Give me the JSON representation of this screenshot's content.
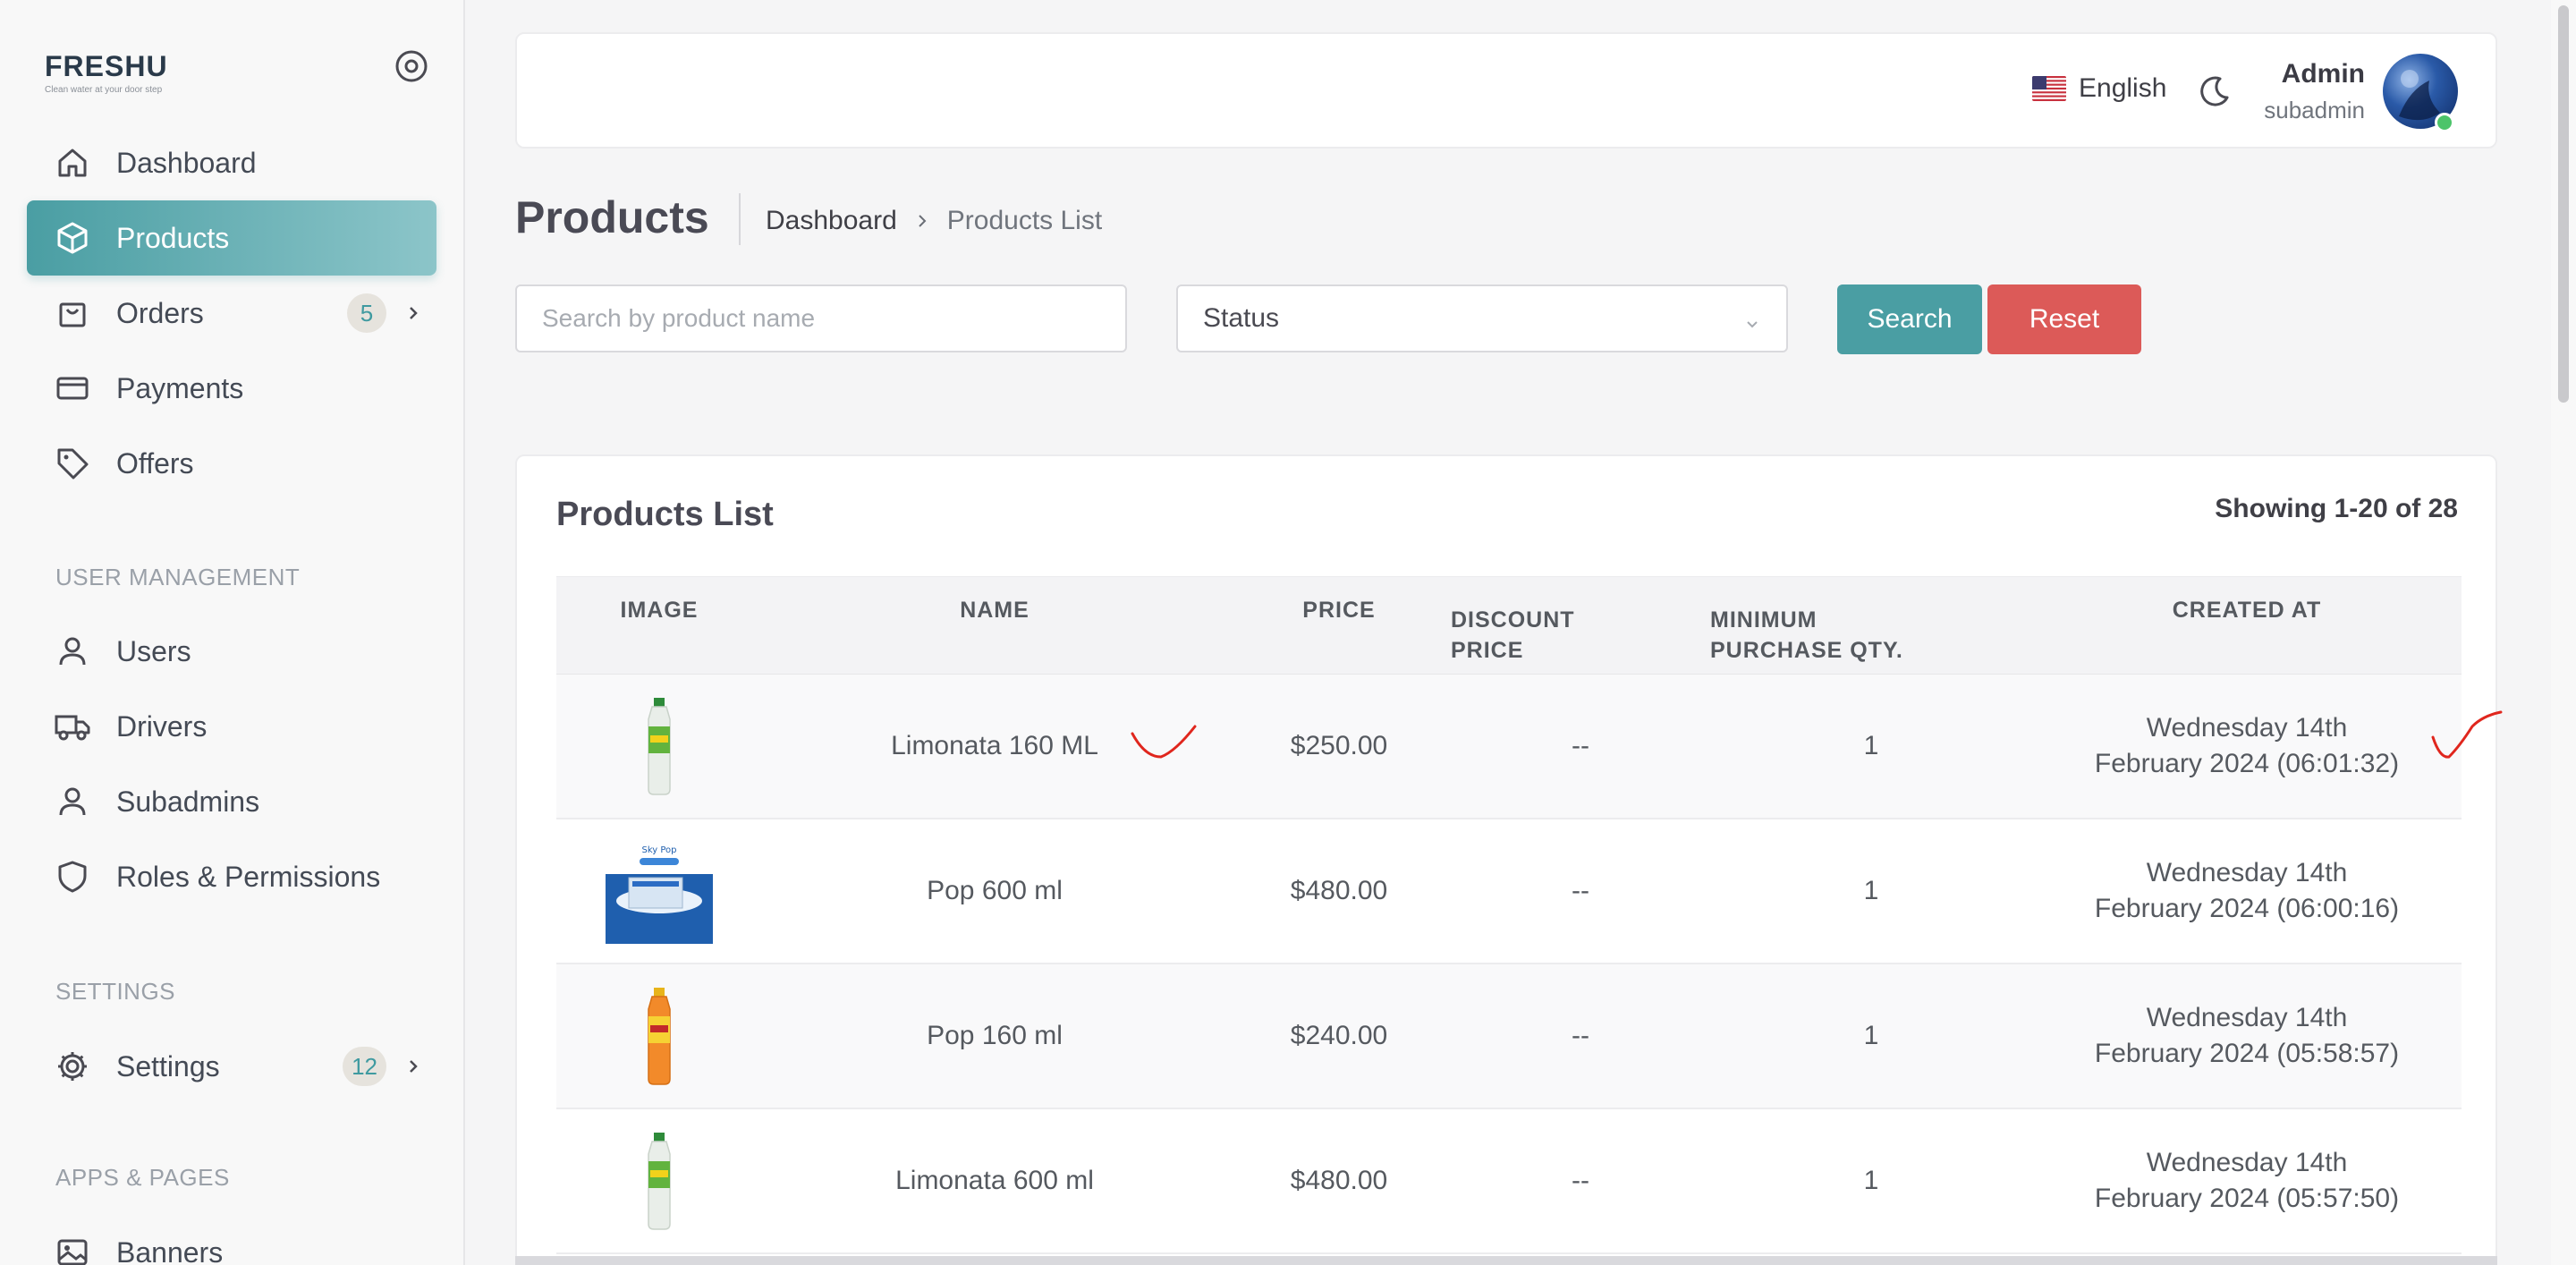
{
  "brand": {
    "name": "FRESHU",
    "tagline": "Clean water at your door step"
  },
  "sidebar": {
    "items": [
      {
        "label": "Dashboard",
        "icon": "home-icon"
      },
      {
        "label": "Products",
        "icon": "box-icon",
        "active": true
      },
      {
        "label": "Orders",
        "icon": "shopping-bag-icon",
        "badge": "5"
      },
      {
        "label": "Payments",
        "icon": "credit-card-icon"
      },
      {
        "label": "Offers",
        "icon": "tag-icon"
      }
    ],
    "sections": {
      "user_management": "USER MANAGEMENT",
      "settings": "SETTINGS",
      "apps_pages": "APPS & PAGES"
    },
    "user_items": [
      {
        "label": "Users",
        "icon": "user-icon"
      },
      {
        "label": "Drivers",
        "icon": "truck-icon"
      },
      {
        "label": "Subadmins",
        "icon": "user-icon"
      },
      {
        "label": "Roles & Permissions",
        "icon": "shield-icon"
      }
    ],
    "settings_item": {
      "label": "Settings",
      "icon": "gear-icon",
      "badge": "12"
    },
    "apps_item": {
      "label": "Banners",
      "icon": "image-icon"
    }
  },
  "topbar": {
    "language": "English",
    "user": {
      "name": "Admin",
      "role": "subadmin"
    }
  },
  "page": {
    "title": "Products",
    "breadcrumb": {
      "root": "Dashboard",
      "current": "Products List"
    }
  },
  "filters": {
    "search_placeholder": "Search by product name",
    "search_value": "",
    "status_label": "Status",
    "search_button": "Search",
    "reset_button": "Reset"
  },
  "table": {
    "title": "Products List",
    "showing": "Showing 1-20 of 28",
    "columns": {
      "image": "IMAGE",
      "name": "NAME",
      "price": "PRICE",
      "discount_1": "DISCOUNT",
      "discount_2": "PRICE",
      "min_1": "MINIMUM",
      "min_2": "PURCHASE QTY.",
      "created": "CREATED AT"
    },
    "rows": [
      {
        "name": "Limonata 160 ML",
        "price": "$250.00",
        "discount": "--",
        "min_qty": "1",
        "created_1": "Wednesday 14th",
        "created_2": "February 2024 (06:01:32)"
      },
      {
        "name": "Pop 600 ml",
        "price": "$480.00",
        "discount": "--",
        "min_qty": "1",
        "created_1": "Wednesday 14th",
        "created_2": "February 2024 (06:00:16)"
      },
      {
        "name": "Pop 160 ml",
        "price": "$240.00",
        "discount": "--",
        "min_qty": "1",
        "created_1": "Wednesday 14th",
        "created_2": "February 2024 (05:58:57)"
      },
      {
        "name": "Limonata 600 ml",
        "price": "$480.00",
        "discount": "--",
        "min_qty": "1",
        "created_1": "Wednesday 14th",
        "created_2": "February 2024 (05:57:50)"
      }
    ]
  },
  "colors": {
    "accent": "#4a9ea3",
    "danger": "#dc5a58",
    "annotation": "#e0261d"
  }
}
